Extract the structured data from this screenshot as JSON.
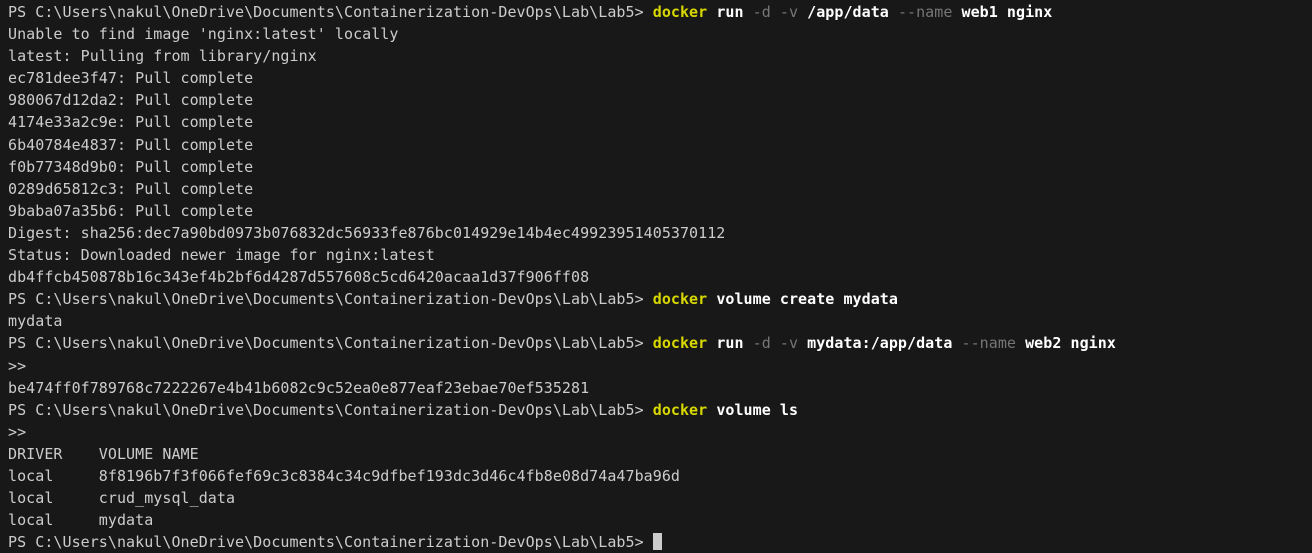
{
  "colors": {
    "background": "#181818",
    "foreground": "#cccccc",
    "command_yellow": "#d8d800",
    "argument_white": "#ffffff",
    "parameter_gray": "#767676",
    "cursor": "#cccccc"
  },
  "terminal": {
    "shell": "PowerShell",
    "prompt": "PS C:\\Users\\nakul\\OneDrive\\Documents\\Containerization-DevOps\\Lab\\Lab5>",
    "lines": [
      {
        "segments": [
          {
            "t": "PS C:\\Users\\nakul\\OneDrive\\Documents\\Containerization-DevOps\\Lab\\Lab5> ",
            "c": "fg"
          },
          {
            "t": "docker",
            "c": "cmd"
          },
          {
            "t": " run ",
            "c": "arg"
          },
          {
            "t": "-d -v",
            "c": "param"
          },
          {
            "t": " /app/data ",
            "c": "arg"
          },
          {
            "t": "--name",
            "c": "param"
          },
          {
            "t": " web1 nginx",
            "c": "arg"
          }
        ]
      },
      {
        "segments": [
          {
            "t": "Unable to find image 'nginx:latest' locally",
            "c": "fg"
          }
        ]
      },
      {
        "segments": [
          {
            "t": "latest: Pulling from library/nginx",
            "c": "fg"
          }
        ]
      },
      {
        "segments": [
          {
            "t": "ec781dee3f47: Pull complete",
            "c": "fg"
          }
        ]
      },
      {
        "segments": [
          {
            "t": "980067d12da2: Pull complete",
            "c": "fg"
          }
        ]
      },
      {
        "segments": [
          {
            "t": "4174e33a2c9e: Pull complete",
            "c": "fg"
          }
        ]
      },
      {
        "segments": [
          {
            "t": "6b40784e4837: Pull complete",
            "c": "fg"
          }
        ]
      },
      {
        "segments": [
          {
            "t": "f0b77348d9b0: Pull complete",
            "c": "fg"
          }
        ]
      },
      {
        "segments": [
          {
            "t": "0289d65812c3: Pull complete",
            "c": "fg"
          }
        ]
      },
      {
        "segments": [
          {
            "t": "9baba07a35b6: Pull complete",
            "c": "fg"
          }
        ]
      },
      {
        "segments": [
          {
            "t": "Digest: sha256:dec7a90bd0973b076832dc56933fe876bc014929e14b4ec49923951405370112",
            "c": "fg"
          }
        ]
      },
      {
        "segments": [
          {
            "t": "Status: Downloaded newer image for nginx:latest",
            "c": "fg"
          }
        ]
      },
      {
        "segments": [
          {
            "t": "db4ffcb450878b16c343ef4b2bf6d4287d557608c5cd6420acaa1d37f906ff08",
            "c": "fg"
          }
        ]
      },
      {
        "segments": [
          {
            "t": "PS C:\\Users\\nakul\\OneDrive\\Documents\\Containerization-DevOps\\Lab\\Lab5> ",
            "c": "fg"
          },
          {
            "t": "docker",
            "c": "cmd"
          },
          {
            "t": " volume create mydata",
            "c": "arg"
          }
        ]
      },
      {
        "segments": [
          {
            "t": "mydata",
            "c": "fg"
          }
        ]
      },
      {
        "segments": [
          {
            "t": "PS C:\\Users\\nakul\\OneDrive\\Documents\\Containerization-DevOps\\Lab\\Lab5> ",
            "c": "fg"
          },
          {
            "t": "docker",
            "c": "cmd"
          },
          {
            "t": " run ",
            "c": "arg"
          },
          {
            "t": "-d -v",
            "c": "param"
          },
          {
            "t": " mydata:/app/data ",
            "c": "arg"
          },
          {
            "t": "--name",
            "c": "param"
          },
          {
            "t": " web2 nginx",
            "c": "arg"
          }
        ]
      },
      {
        "segments": [
          {
            "t": ">>",
            "c": "fg"
          }
        ]
      },
      {
        "segments": [
          {
            "t": "be474ff0f789768c7222267e4b41b6082c9c52ea0e877eaf23ebae70ef535281",
            "c": "fg"
          }
        ]
      },
      {
        "segments": [
          {
            "t": "PS C:\\Users\\nakul\\OneDrive\\Documents\\Containerization-DevOps\\Lab\\Lab5> ",
            "c": "fg"
          },
          {
            "t": "docker",
            "c": "cmd"
          },
          {
            "t": " volume ls",
            "c": "arg"
          }
        ]
      },
      {
        "segments": [
          {
            "t": ">>",
            "c": "fg"
          }
        ]
      },
      {
        "segments": [
          {
            "t": "DRIVER    VOLUME NAME",
            "c": "fg"
          }
        ]
      },
      {
        "segments": [
          {
            "t": "local     8f8196b7f3f066fef69c3c8384c34c9dfbef193dc3d46c4fb8e08d74a47ba96d",
            "c": "fg"
          }
        ]
      },
      {
        "segments": [
          {
            "t": "local     crud_mysql_data",
            "c": "fg"
          }
        ]
      },
      {
        "segments": [
          {
            "t": "local     mydata",
            "c": "fg"
          }
        ]
      },
      {
        "segments": [
          {
            "t": "PS C:\\Users\\nakul\\OneDrive\\Documents\\Containerization-DevOps\\Lab\\Lab5> ",
            "c": "fg"
          }
        ],
        "cursor": true
      }
    ]
  }
}
